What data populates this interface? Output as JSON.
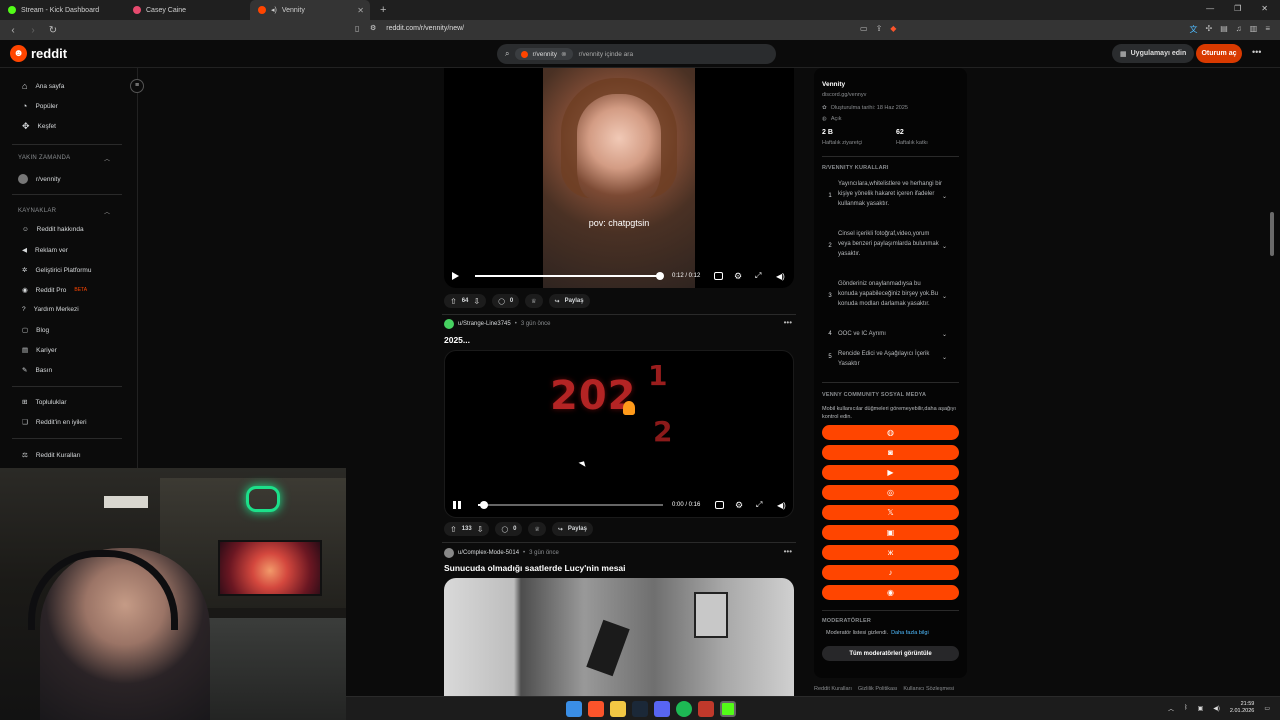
{
  "browser": {
    "tabs": [
      {
        "label": "Stream - Kick Dashboard",
        "active": false
      },
      {
        "label": "Casey Caine",
        "active": false
      },
      {
        "label": "Vennity",
        "active": true
      }
    ],
    "new_tab_glyph": "+",
    "url": "reddit.com/r/vennity/new/"
  },
  "header": {
    "logo_text": "reddit",
    "search_chip": "r/vennity",
    "search_placeholder": "r/vennity içinde ara",
    "get_app_label": "Uygulamayı edin",
    "login_label": "Oturum aç"
  },
  "sidebar": {
    "main": [
      {
        "label": "Ana sayfa",
        "icon": "home-icon"
      },
      {
        "label": "Popüler",
        "icon": "popular-icon"
      },
      {
        "label": "Keşfet",
        "icon": "explore-icon"
      }
    ],
    "recent_heading": "YAKIN ZAMANDA",
    "recent": [
      {
        "label": "r/vennity"
      }
    ],
    "resources_heading": "KAYNAKLAR",
    "resources": [
      {
        "label": "Reddit hakkında"
      },
      {
        "label": "Reklam ver"
      },
      {
        "label": "Geliştirici Platformu"
      },
      {
        "label": "Reddit Pro",
        "badge": "BETA"
      },
      {
        "label": "Yardım Merkezi"
      },
      {
        "label": "Blog"
      },
      {
        "label": "Kariyer"
      },
      {
        "label": "Basın"
      }
    ],
    "extra": [
      {
        "label": "Topluluklar"
      },
      {
        "label": "Reddit'in en iyileri"
      }
    ],
    "rules_link": "Reddit Kuralları"
  },
  "posts": [
    {
      "video_caption": "pov: chatpgtsin",
      "time": "0:12 / 0:12",
      "progress": 1.0,
      "votes": "64",
      "comments": "0",
      "share": "Paylaş"
    },
    {
      "author": "u/Strange-Line3745",
      "time_ago": "3 gün önce",
      "title": "2025...",
      "video_text_main": "202",
      "video_text_up": "1",
      "video_text_down": "2",
      "time": "0:00 / 0:16",
      "progress": 0.03,
      "votes": "133",
      "comments": "0",
      "share": "Paylaş"
    },
    {
      "author": "u/Complex-Mode-5014",
      "time_ago": "3 gün önce",
      "title": "Sunucuda olmadığı saatlerde Lucy'nin mesai"
    }
  ],
  "community": {
    "name": "Vennity",
    "link": "discord.gg/vennyv",
    "created": "Oluşturulma tarihi: 18 Haz 2025",
    "visibility": "Açık",
    "visitors_value": "2 B",
    "visitors_label": "Haftalık ziyaretçi",
    "contrib_value": "62",
    "contrib_label": "Haftalık katkı",
    "rules_heading": "R/VENNITY KURALLARI",
    "rules": [
      {
        "n": "1",
        "text": "Yayıncılara,whitelistlere ve herhangi bir kişiye yönelik hakaret içeren ifadeler kullanmak yasaktır."
      },
      {
        "n": "2",
        "text": "Cinsel içerikli fotoğraf,video,yorum veya benzeri paylaşımlarda bulunmak yasaktır."
      },
      {
        "n": "3",
        "text": "Gönderiniz onaylanmadıysa bu konuda yapabileceğiniz birşey yok.Bu konuda modları darlamak yasaktır."
      },
      {
        "n": "4",
        "text": "OOC ve IC Ayrımı"
      },
      {
        "n": "5",
        "text": "Rencide Edici ve Aşağılayıcı İçerik Yasaktır"
      }
    ],
    "social_heading": "VENNY COMMUNITY SOSYAL MEDYA",
    "social_note": "Mobil kullanıcılar düğmeleri göremeyebilir,daha aşağıyı kontrol edin.",
    "social_buttons": [
      {
        "icon": "globe-icon",
        "glyph": "◍"
      },
      {
        "icon": "discord-icon",
        "glyph": "◙"
      },
      {
        "icon": "youtube-icon",
        "glyph": "▶"
      },
      {
        "icon": "instagram-icon",
        "glyph": "◎"
      },
      {
        "icon": "x-icon",
        "glyph": "𝕏"
      },
      {
        "icon": "twitch-icon",
        "glyph": "▣"
      },
      {
        "icon": "kick-icon",
        "glyph": "ж"
      },
      {
        "icon": "tiktok-icon",
        "glyph": "♪"
      },
      {
        "icon": "steam-icon",
        "glyph": "◉"
      }
    ],
    "mods_heading": "MODERATÖRLER",
    "mods_note": "Moderatör listesi gizlendi.",
    "mods_more": "Daha fazla bilgi",
    "mods_button": "Tüm moderatörleri görüntüle",
    "footer": [
      "Reddit Kuralları",
      "Gizlilik Politikası",
      "Kullanıcı Sözleşmesi"
    ]
  },
  "taskbar": {
    "time": "21:59",
    "date": "2.01.2026",
    "apps": [
      "windows-start-icon",
      "brave-icon",
      "file-explorer-icon",
      "steam-icon",
      "discord-icon",
      "spotify-icon",
      "app-icon",
      "kick-icon"
    ]
  },
  "colors": {
    "accent": "#ff4500",
    "login": "#d93a00",
    "bg": "#0b0b0b"
  }
}
